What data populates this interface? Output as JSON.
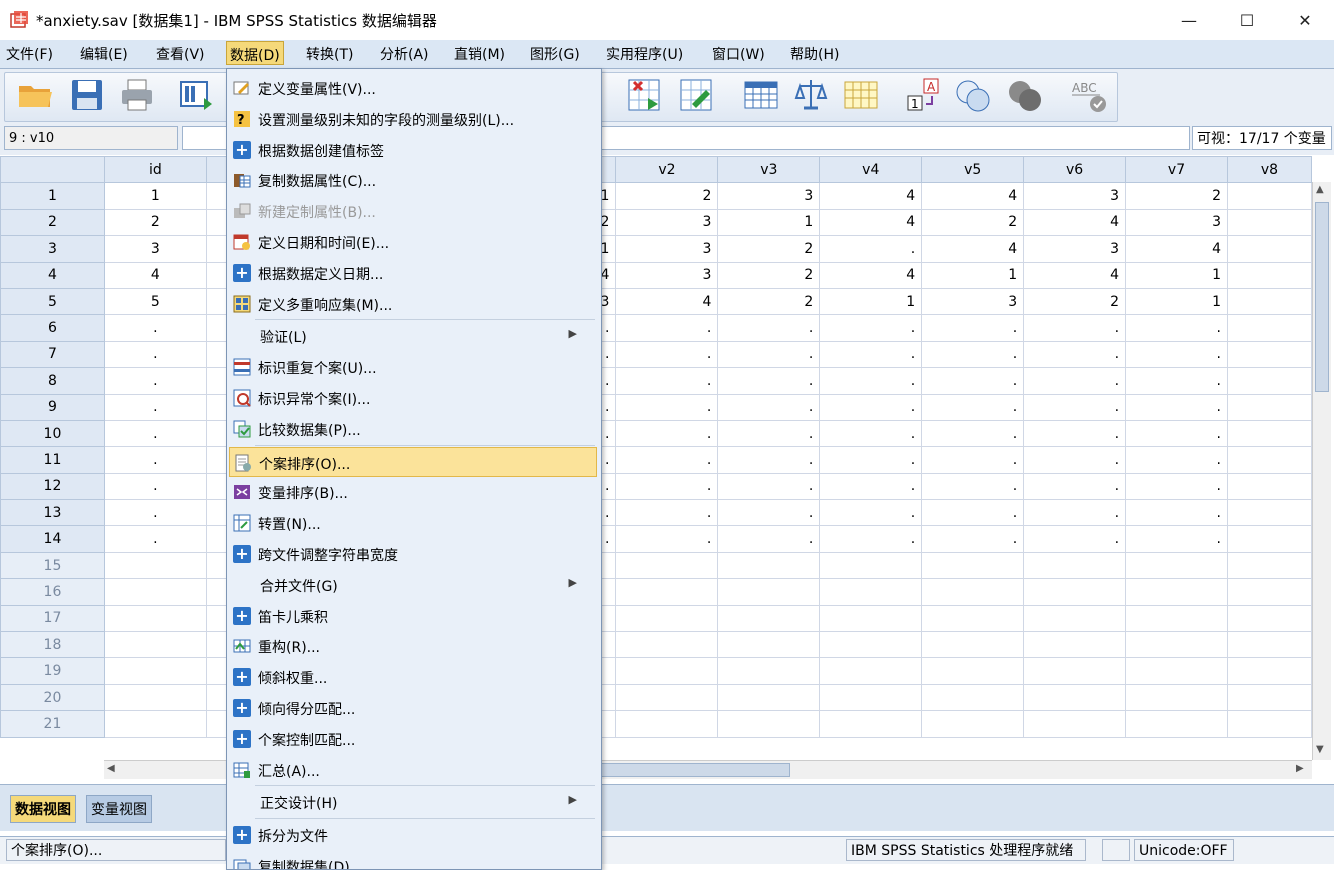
{
  "window": {
    "title": "*anxiety.sav [数据集1] - IBM SPSS Statistics 数据编辑器"
  },
  "menubar": [
    "文件(F)",
    "编辑(E)",
    "查看(V)",
    "数据(D)",
    "转换(T)",
    "分析(A)",
    "直销(M)",
    "图形(G)",
    "实用程序(U)",
    "窗口(W)",
    "帮助(H)"
  ],
  "cellref": "9 : v10",
  "visible": "可视：17/17 个变量",
  "columns": [
    "id",
    "",
    "v2",
    "v3",
    "v4",
    "v5",
    "v6",
    "v7",
    "v8"
  ],
  "rows": [
    {
      "n": "1",
      "id": "1",
      "c": "1",
      "v2": "2",
      "v3": "3",
      "v4": "4",
      "v5": "4",
      "v6": "3",
      "v7": "2"
    },
    {
      "n": "2",
      "id": "2",
      "c": "2",
      "v2": "3",
      "v3": "1",
      "v4": "4",
      "v5": "2",
      "v6": "4",
      "v7": "3"
    },
    {
      "n": "3",
      "id": "3",
      "c": "1",
      "v2": "3",
      "v3": "2",
      "v4": ".",
      "v5": "4",
      "v6": "3",
      "v7": "4"
    },
    {
      "n": "4",
      "id": "4",
      "c": "4",
      "v2": "3",
      "v3": "2",
      "v4": "4",
      "v5": "1",
      "v6": "4",
      "v7": "1"
    },
    {
      "n": "5",
      "id": "5",
      "c": "3",
      "v2": "4",
      "v3": "2",
      "v4": "1",
      "v5": "3",
      "v6": "2",
      "v7": "1"
    },
    {
      "n": "6",
      "id": ".",
      "c": ".",
      "v2": ".",
      "v3": ".",
      "v4": ".",
      "v5": ".",
      "v6": ".",
      "v7": "."
    },
    {
      "n": "7",
      "id": ".",
      "c": ".",
      "v2": ".",
      "v3": ".",
      "v4": ".",
      "v5": ".",
      "v6": ".",
      "v7": "."
    },
    {
      "n": "8",
      "id": ".",
      "c": ".",
      "v2": ".",
      "v3": ".",
      "v4": ".",
      "v5": ".",
      "v6": ".",
      "v7": "."
    },
    {
      "n": "9",
      "id": ".",
      "c": ".",
      "v2": ".",
      "v3": ".",
      "v4": ".",
      "v5": ".",
      "v6": ".",
      "v7": "."
    },
    {
      "n": "10",
      "id": ".",
      "c": ".",
      "v2": ".",
      "v3": ".",
      "v4": ".",
      "v5": ".",
      "v6": ".",
      "v7": "."
    },
    {
      "n": "11",
      "id": ".",
      "c": ".",
      "v2": ".",
      "v3": ".",
      "v4": ".",
      "v5": ".",
      "v6": ".",
      "v7": "."
    },
    {
      "n": "12",
      "id": ".",
      "c": ".",
      "v2": ".",
      "v3": ".",
      "v4": ".",
      "v5": ".",
      "v6": ".",
      "v7": "."
    },
    {
      "n": "13",
      "id": ".",
      "c": ".",
      "v2": ".",
      "v3": ".",
      "v4": ".",
      "v5": ".",
      "v6": ".",
      "v7": "."
    },
    {
      "n": "14",
      "id": ".",
      "c": ".",
      "v2": ".",
      "v3": ".",
      "v4": ".",
      "v5": ".",
      "v6": ".",
      "v7": "."
    },
    {
      "n": "15",
      "id": "",
      "c": "",
      "v2": "",
      "v3": "",
      "v4": "",
      "v5": "",
      "v6": "",
      "v7": ""
    },
    {
      "n": "16",
      "id": "",
      "c": "",
      "v2": "",
      "v3": "",
      "v4": "",
      "v5": "",
      "v6": "",
      "v7": ""
    },
    {
      "n": "17",
      "id": "",
      "c": "",
      "v2": "",
      "v3": "",
      "v4": "",
      "v5": "",
      "v6": "",
      "v7": ""
    },
    {
      "n": "18",
      "id": "",
      "c": "",
      "v2": "",
      "v3": "",
      "v4": "",
      "v5": "",
      "v6": "",
      "v7": ""
    },
    {
      "n": "19",
      "id": "",
      "c": "",
      "v2": "",
      "v3": "",
      "v4": "",
      "v5": "",
      "v6": "",
      "v7": ""
    },
    {
      "n": "20",
      "id": "",
      "c": "",
      "v2": "",
      "v3": "",
      "v4": "",
      "v5": "",
      "v6": "",
      "v7": ""
    },
    {
      "n": "21",
      "id": "",
      "c": "",
      "v2": "",
      "v3": "",
      "v4": "",
      "v5": "",
      "v6": "",
      "v7": ""
    }
  ],
  "data_menu": [
    {
      "label": "定义变量属性(V)...",
      "icon": "define-properties-icon"
    },
    {
      "label": "设置测量级别未知的字段的测量级别(L)...",
      "icon": "measurement-level-icon"
    },
    {
      "label": "根据数据创建值标签",
      "icon": "plus-icon"
    },
    {
      "label": "复制数据属性(C)...",
      "icon": "copy-properties-icon"
    },
    {
      "label": "新建定制属性(B)...",
      "icon": "custom-attribute-icon",
      "disabled": true
    },
    {
      "label": "定义日期和时间(E)...",
      "icon": "calendar-icon"
    },
    {
      "label": "根据数据定义日期...",
      "icon": "plus-icon"
    },
    {
      "label": "定义多重响应集(M)...",
      "icon": "multiple-response-icon"
    },
    {
      "label": "验证(L)",
      "submenu": true,
      "sep_before": true
    },
    {
      "label": "标识重复个案(U)...",
      "icon": "duplicate-cases-icon"
    },
    {
      "label": "标识异常个案(I)...",
      "icon": "unusual-cases-icon"
    },
    {
      "label": "比较数据集(P)...",
      "icon": "compare-datasets-icon"
    },
    {
      "label": "个案排序(O)...",
      "icon": "sort-cases-icon",
      "highlighted": true,
      "sep_before": true
    },
    {
      "label": "变量排序(B)...",
      "icon": "sort-variables-icon"
    },
    {
      "label": "转置(N)...",
      "icon": "transpose-icon"
    },
    {
      "label": "跨文件调整字符串宽度",
      "icon": "plus-icon"
    },
    {
      "label": "合并文件(G)",
      "submenu": true
    },
    {
      "label": "笛卡儿乘积",
      "icon": "plus-icon"
    },
    {
      "label": "重构(R)...",
      "icon": "restructure-icon"
    },
    {
      "label": "倾斜权重...",
      "icon": "plus-icon"
    },
    {
      "label": "倾向得分匹配...",
      "icon": "plus-icon"
    },
    {
      "label": "个案控制匹配...",
      "icon": "plus-icon"
    },
    {
      "label": "汇总(A)...",
      "icon": "aggregate-icon"
    },
    {
      "label": "正交设计(H)",
      "submenu": true,
      "sep_before": true
    },
    {
      "label": "拆分为文件",
      "icon": "plus-icon",
      "sep_before": true
    },
    {
      "label": "复制数据集(D)",
      "icon": "copy-dataset-icon"
    }
  ],
  "tabs": {
    "data_view": "数据视图",
    "variable_view": "变量视图"
  },
  "status": {
    "left": "个案排序(O)...",
    "processor": "IBM SPSS Statistics 处理程序就绪",
    "unicode": "Unicode:OFF"
  },
  "colors": {
    "accent": "#f5d97a",
    "menubar": "#dbe7f4",
    "header": "#dfe8f4"
  }
}
